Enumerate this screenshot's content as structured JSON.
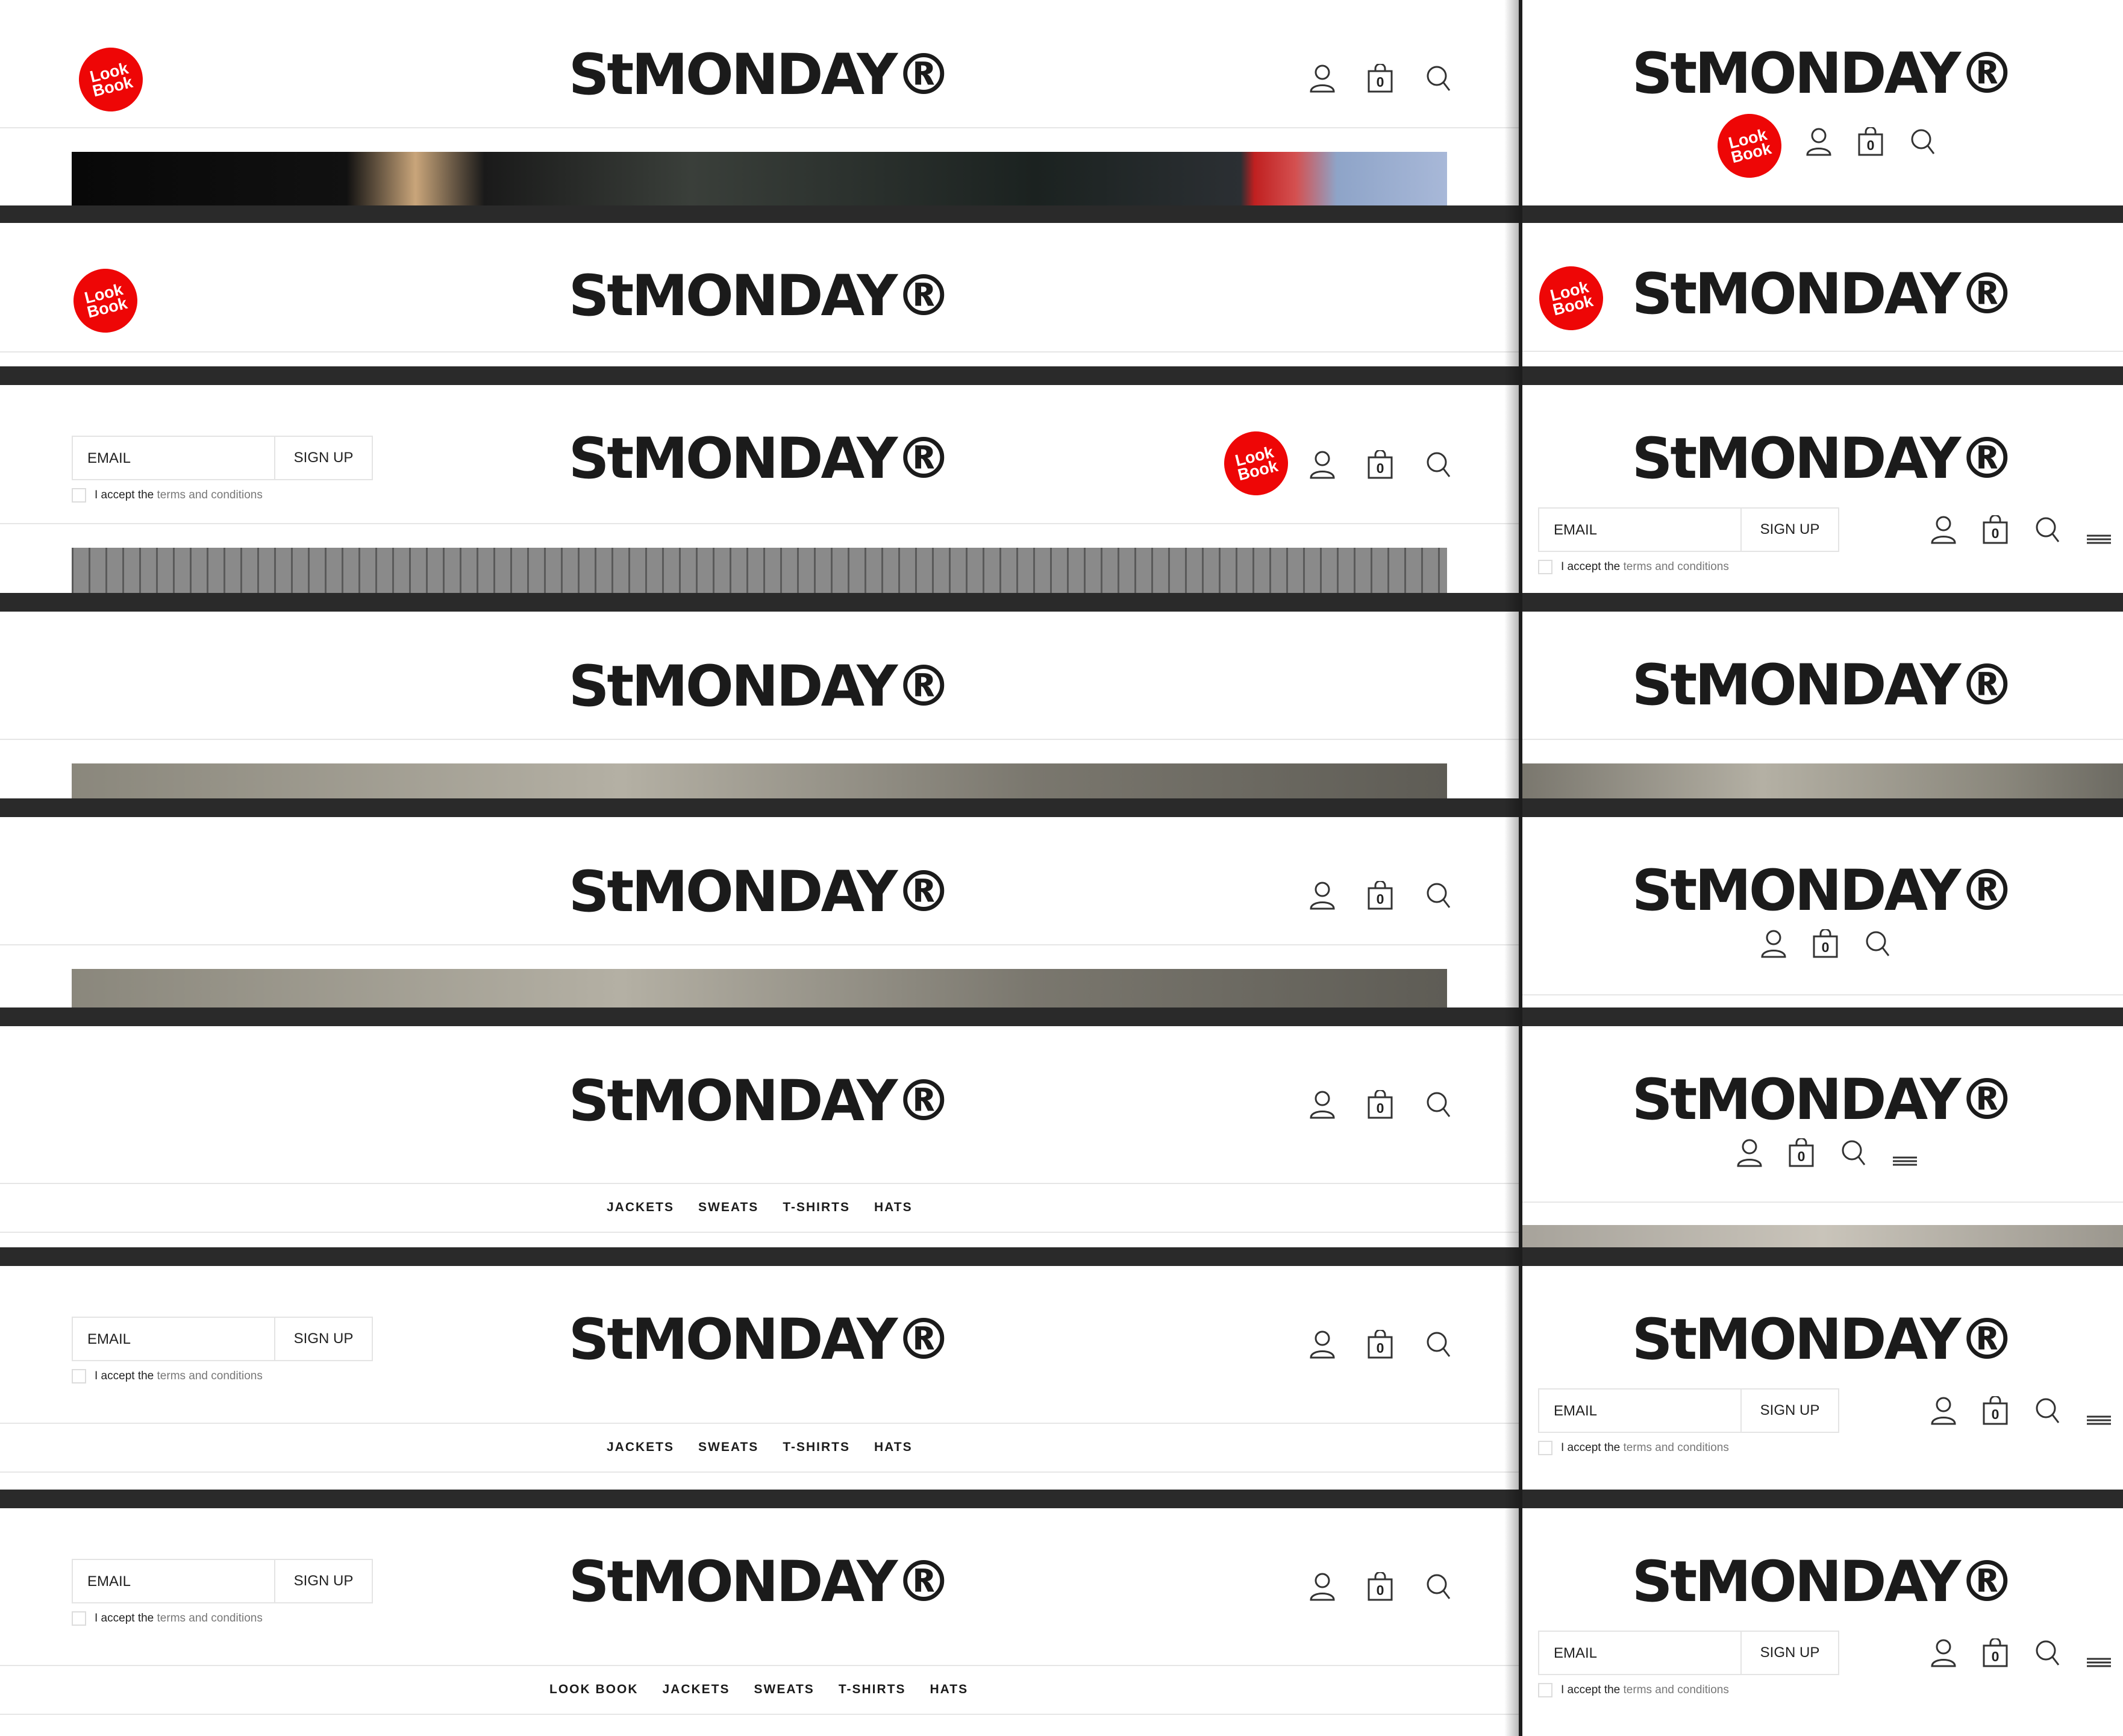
{
  "brand": "StMONDAY®",
  "lookbook": {
    "line1": "Look",
    "line2": "Book"
  },
  "cart_count": "0",
  "newsletter": {
    "email_label": "EMAIL",
    "signup_label": "SIGN UP",
    "terms_prefix": "I accept the",
    "terms_link": "terms and conditions"
  },
  "nav_short": [
    "JACKETS",
    "SWEATS",
    "T-SHIRTS",
    "HATS"
  ],
  "nav_full": [
    "LOOK BOOK",
    "JACKETS",
    "SWEATS",
    "T-SHIRTS",
    "HATS"
  ],
  "colors": {
    "accent": "#ee0606",
    "text": "#1b1b1b",
    "divider": "#2a2a2a"
  },
  "icons": [
    "user-icon",
    "bag-icon",
    "search-icon",
    "menu-icon"
  ]
}
